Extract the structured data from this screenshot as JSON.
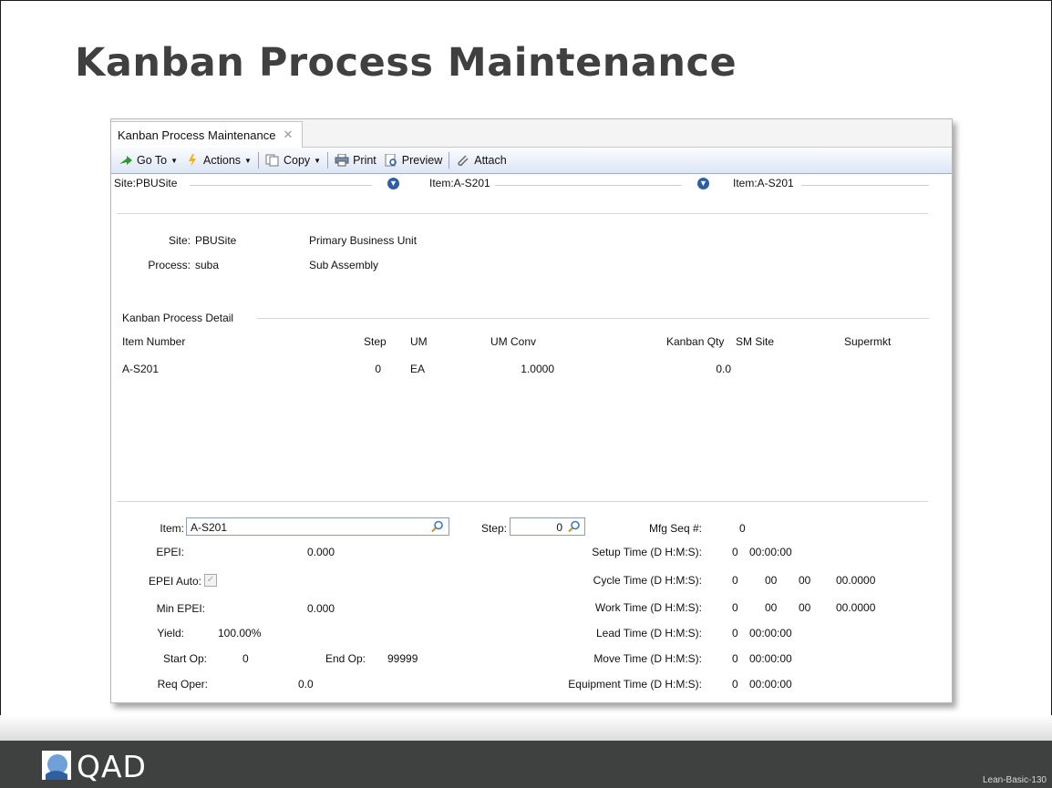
{
  "slide_title": "Kanban Process Maintenance",
  "tab": {
    "label": "Kanban Process Maintenance",
    "close": "✕"
  },
  "toolbar": {
    "goto": "Go To",
    "actions": "Actions",
    "copy": "Copy",
    "print": "Print",
    "preview": "Preview",
    "attach": "Attach"
  },
  "keys": {
    "site": "Site:PBUSite",
    "item1": "Item:A-S201",
    "item2": "Item:A-S201"
  },
  "header": {
    "site_label": "Site:",
    "site_value": "PBUSite",
    "site_desc": "Primary Business Unit",
    "process_label": "Process:",
    "process_value": "suba",
    "process_desc": "Sub Assembly"
  },
  "detail": {
    "section_label": "Kanban Process Detail",
    "columns": [
      "Item Number",
      "Step",
      "UM",
      "UM Conv",
      "Kanban Qty",
      "SM Site",
      "Supermkt"
    ],
    "rows": [
      {
        "item": "A-S201",
        "step": "0",
        "um": "EA",
        "um_conv": "1.0000",
        "kanban_qty": "0.0",
        "sm_site": "",
        "supermkt": ""
      }
    ]
  },
  "form": {
    "item_label": "Item:",
    "item_value": "A-S201",
    "step_label": "Step:",
    "step_value": "0",
    "mfg_seq_label": "Mfg Seq #:",
    "mfg_seq_value": "0",
    "epei_label": "EPEI:",
    "epei_value": "0.000",
    "epei_auto_label": "EPEI Auto:",
    "epei_auto_checked": true,
    "min_epei_label": "Min EPEI:",
    "min_epei_value": "0.000",
    "yield_label": "Yield:",
    "yield_value": "100.00%",
    "start_op_label": "Start Op:",
    "start_op_value": "0",
    "end_op_label": "End Op:",
    "end_op_value": "99999",
    "req_oper_label": "Req Oper:",
    "req_oper_value": "0.0",
    "times": [
      {
        "label": "Setup Time (D H:M:S):",
        "d": "0",
        "h": "00:00:00",
        "m": "",
        "s": ""
      },
      {
        "label": "Cycle Time (D H:M:S):",
        "d": "0",
        "h": "00",
        "m": "00",
        "s": "00.0000"
      },
      {
        "label": "Work Time (D H:M:S):",
        "d": "0",
        "h": "00",
        "m": "00",
        "s": "00.0000"
      },
      {
        "label": "Lead Time (D H:M:S):",
        "d": "0",
        "h": "00:00:00",
        "m": "",
        "s": ""
      },
      {
        "label": "Move Time (D H:M:S):",
        "d": "0",
        "h": "00:00:00",
        "m": "",
        "s": ""
      },
      {
        "label": "Equipment Time (D H:M:S):",
        "d": "0",
        "h": "00:00:00",
        "m": "",
        "s": ""
      }
    ]
  },
  "footer": {
    "logo": "QAD",
    "slide_id": "Lean-Basic-130"
  }
}
